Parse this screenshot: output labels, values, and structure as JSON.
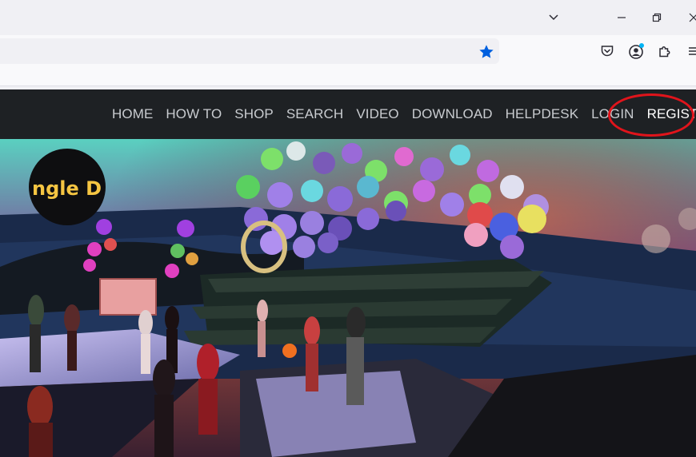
{
  "browser": {
    "icons": {
      "tabs_menu": "chevron-down-icon",
      "minimize": "minimize-icon",
      "restore": "restore-icon",
      "close": "close-icon",
      "bookmark": "star-icon",
      "pocket": "pocket-icon",
      "account": "account-icon",
      "extensions": "puzzle-icon",
      "menu": "hamburger-menu-icon"
    },
    "accent_color": "#0060df"
  },
  "site": {
    "nav": [
      {
        "label": "HOME"
      },
      {
        "label": "HOW TO"
      },
      {
        "label": "SHOP"
      },
      {
        "label": "SEARCH"
      },
      {
        "label": "VIDEO"
      },
      {
        "label": "DOWNLOAD"
      },
      {
        "label": "HELPDESK"
      },
      {
        "label": "LOGIN"
      },
      {
        "label": "REGISTER"
      }
    ],
    "annotation_color": "#e0141b",
    "hero_sign_text": "ngle D"
  }
}
